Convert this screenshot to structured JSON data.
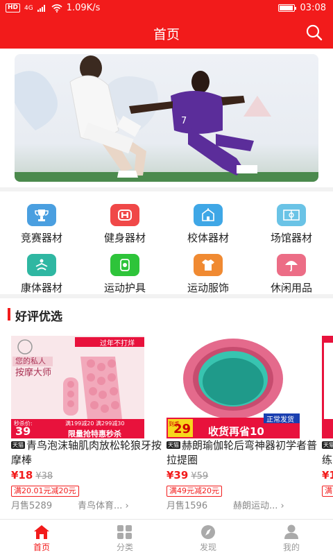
{
  "status_bar": {
    "hd": "HD",
    "signal": "4G",
    "speed": "1.09K/s",
    "time": "03:08"
  },
  "header": {
    "title": "首页"
  },
  "categories": [
    {
      "label": "竞赛器材",
      "icon": "trophy-icon",
      "color": "#4a9fe0"
    },
    {
      "label": "健身器材",
      "icon": "fitness-icon",
      "color": "#f04848"
    },
    {
      "label": "校体器材",
      "icon": "school-icon",
      "color": "#3fa7e6"
    },
    {
      "label": "场馆器材",
      "icon": "field-icon",
      "color": "#6ac3e6"
    },
    {
      "label": "康体器材",
      "icon": "yoga-icon",
      "color": "#2fb7a2"
    },
    {
      "label": "运动护具",
      "icon": "knee-guard-icon",
      "color": "#2ec43a"
    },
    {
      "label": "运动服饰",
      "icon": "shirt-icon",
      "color": "#f08a32"
    },
    {
      "label": "休闲用品",
      "icon": "umbrella-icon",
      "color": "#ec6d86"
    }
  ],
  "section": {
    "title": "好评优选"
  },
  "products": [
    {
      "badge": "天猫",
      "title": "青鸟泡沫轴肌肉放松轮狼牙按摩棒",
      "price": "¥18",
      "old_price": "¥38",
      "coupon": "满20.01元减20元",
      "sold": "月售5289",
      "shop": "青鸟体育... ›",
      "img_text": {
        "tag": "过年不打烊",
        "line1": "您的私人",
        "line2": "按摩大师",
        "promo": "限量抢特惠秒杀",
        "price": "39",
        "price_label": "秒杀价:",
        "deal": "满199减20 满299减30"
      }
    },
    {
      "badge": "天猫",
      "title": "赫朗瑜伽轮后弯神器初学者普拉提圈",
      "price": "¥39",
      "old_price": "¥59",
      "coupon": "满49元减20元",
      "sold": "月售1596",
      "shop": "赫朗运动... ›",
      "img_text": {
        "tag": "正常发货",
        "promo": "收货再省10",
        "price": "29",
        "price_label": "到手"
      }
    },
    {
      "badge": "天猫",
      "title": "练",
      "price": "¥1",
      "coupon": "满",
      "sold": ""
    }
  ],
  "tabs": [
    {
      "label": "首页",
      "icon": "home-icon",
      "active": true
    },
    {
      "label": "分类",
      "icon": "grid-icon",
      "active": false
    },
    {
      "label": "发现",
      "icon": "compass-icon",
      "active": false
    },
    {
      "label": "我的",
      "icon": "user-icon",
      "active": false
    }
  ],
  "colors": {
    "brand_red": "#f21b1b",
    "text": "#222222",
    "muted": "#999999"
  }
}
